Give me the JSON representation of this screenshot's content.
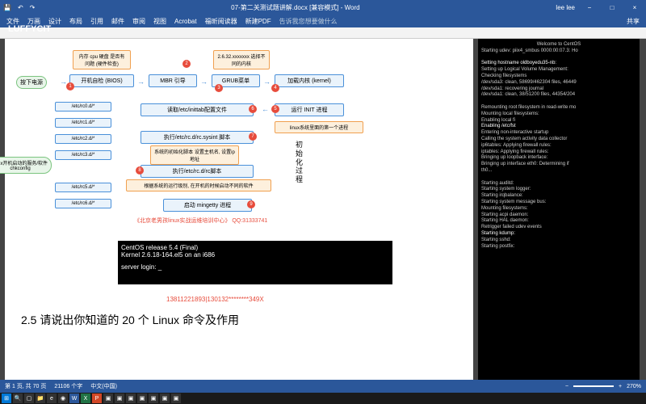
{
  "titlebar": {
    "doc_title": "07-第二关测试题讲解.docx [兼容模式] - Word",
    "user": "lee lee"
  },
  "ribbon": {
    "tabs": [
      "文件",
      "万画",
      "设计",
      "布局",
      "引用",
      "邮件",
      "审阅",
      "视图",
      "Acrobat",
      "福昕阅读器",
      "新建PDF"
    ],
    "tell_me": "告诉我您想要做什么",
    "share": "共享"
  },
  "logo": "LUFFYCIT",
  "flow": {
    "power": "按下电源",
    "bios": "开机自检 (BIOS)",
    "bios_note": "内存 cpu 硬盘 是否有问题 (硬件检查)",
    "mbr": "MBR 引导",
    "grub": "GRUB菜单",
    "grub_note": "2.6.32.xxxxxxx 选择不同的内核",
    "kernel": "加载内核 (kernel)",
    "init": "运行 INIT 进程",
    "init_note": "linux系统里面的第一个进程",
    "inittab": "读取/etc/inittab配置文件",
    "sysint": "执行/etc/rc.d/rc.sysint 脚本",
    "sysint_note": "系统的初始化脚本 设置主机名, 设置ip地址",
    "rcscript": "执行/etc/rc.d/rc脚本",
    "rcscript_note": "根据系统的运行级别, 在开机的时候启动不同的软件",
    "mingetty": "启动 mingetty 进程",
    "init_proc": "初始化过程",
    "rc_dirs": [
      "/etc/rc0.d/*",
      "/etc/rc1.d/*",
      "/etc/rc2.d/*",
      "/etc/rc3.d/*",
      "/etc/rc5.d/*",
      "/etc/rc6.d/*"
    ],
    "chkconfig": "linux开机启动的服务/软件 chkconfig",
    "footer_red": "《北京老男孩linux实战运维培训中心》  QQ:31333741"
  },
  "term_inline": {
    "l1": "CentOS release 5.4 (Final)",
    "l2": "Kernel 2.6.18-164.el5 on an i686",
    "l3": "server login: _"
  },
  "phone": "13811221893|130132********349X",
  "heading": "2.5 请说出你知道的 20 个 Linux 命令及作用",
  "side_term": {
    "welcome": "Welcome to CentOS",
    "udev": "Starting udev:   piix4_smbus  0000:00:07.3: Ho",
    "hostname": "Setting hostname oldboyedu35-nb:",
    "lvm": "Setting up Logical Volume Management:",
    "chkfs": "Checking filesystems",
    "sda3": "/dev/sda3: clean, 58699/462304 files, 46449",
    "sda1": "/dev/sda1: recovering journal",
    "sda1b": "/dev/sda1: clean, 38/51200 files, 44354/204",
    "remount": "Remounting root filesystem in read-write mo",
    "mount": "Mounting local filesystems:",
    "enable": "Enabling local fi",
    "fstab": "Enabling /etc/fst",
    "noninteractive": "Entering non-interactive startup",
    "syscol": "Calling the system activity data collector",
    "ip6": "ip6tables: Applying firewall rules:",
    "ipt": "iptables: Applying firewall rules:",
    "loop": "Bringing up loopback interface:",
    "eth0": "Bringing up interface eth0:  Determining if",
    "th0": "th0...",
    "auditd": "Starting auditd:",
    "syslog": "Starting system logger:",
    "irq": "Starting irqbalance:",
    "msgbus": "Starting system message bus:",
    "mountfs": "Mounting filesystems:",
    "acpi": "Starting acpi daemon:",
    "hal": "Starting HAL daemon:",
    "retr": "Retrigger failed udev events",
    "kdump": "Starting kdump:",
    "sshd": "Starting sshd:",
    "postfix": "Starting postfix:"
  },
  "statusbar": {
    "page": "第 1 页, 共 70 页",
    "words": "21106 个字",
    "lang": "中文(中国)",
    "zoom": "270%"
  },
  "win_controls": {
    "min": "−",
    "max": "□",
    "close": "×"
  }
}
